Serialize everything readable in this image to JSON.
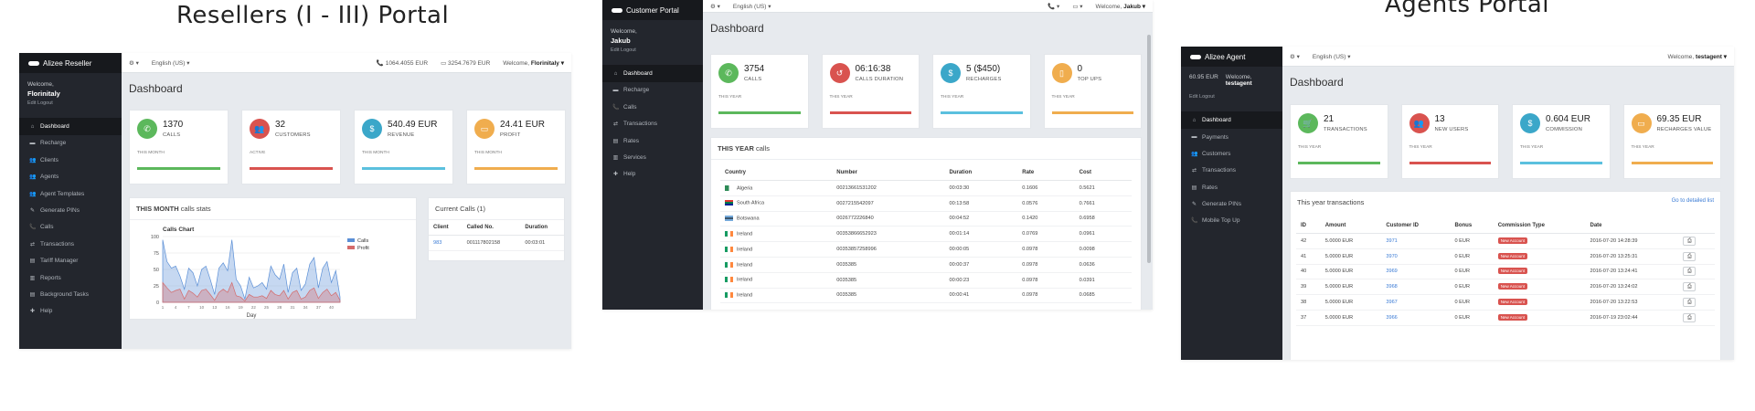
{
  "titles": {
    "reseller": "Resellers (I - III) Portal",
    "agent": "Agents Portal"
  },
  "colors": {
    "green": "#5cb85c",
    "red": "#d9534f",
    "blue": "#5bc0de",
    "orange": "#f0ad4e",
    "cyan": "#3ba7c9"
  },
  "reseller": {
    "brand": "Alizee Reseller",
    "welcome": "Welcome,",
    "user": "Florinitaly",
    "links": "Edit  Logout",
    "topbar": {
      "settings": "⚙ ▾",
      "lang": "English (US) ▾",
      "balance1": "📞 1064.4055 EUR",
      "balance2": "▭ 3254.7679 EUR",
      "welcome_label": "Welcome,",
      "welcome_user": "Florinitaly ▾"
    },
    "nav": [
      "Dashboard",
      "Recharge",
      "Clients",
      "Agents",
      "Agent Templates",
      "Generate PINs",
      "Calls",
      "Transactions",
      "Tariff Manager",
      "Reports",
      "Background Tasks",
      "Help"
    ],
    "nav_icons": [
      "⌂",
      "▬",
      "👥",
      "👥",
      "👥",
      "✎",
      "📞",
      "⇄",
      "▤",
      "▥",
      "▤",
      "✚"
    ],
    "dashboard": "Dashboard",
    "cards": [
      {
        "value": "1370",
        "label": "CALLS",
        "period": "THIS MONTH",
        "icon": "phone-icon",
        "glyph": "✆"
      },
      {
        "value": "32",
        "label": "CUSTOMERS",
        "period": "ACTIVE",
        "icon": "users-icon",
        "glyph": "👥"
      },
      {
        "value": "540.49 EUR",
        "label": "REVENUE",
        "period": "THIS MONTH",
        "icon": "money-icon",
        "glyph": "$"
      },
      {
        "value": "24.41 EUR",
        "label": "PROFIT",
        "period": "THIS MONTH",
        "icon": "credit-card-icon",
        "glyph": "▭"
      }
    ],
    "stats_head_bold": "THIS MONTH",
    "stats_head_rest": " calls stats",
    "current_calls": "Current Calls (1)",
    "current_cols": [
      "Client",
      "Called No.",
      "Duration"
    ],
    "current_rows": [
      [
        "983",
        "001117802158",
        "00:03:01"
      ]
    ]
  },
  "chart_data": {
    "type": "area",
    "title": "Calls Chart",
    "xlabel": "Day",
    "ylabel": "",
    "ylim": [
      0,
      100
    ],
    "yticks": [
      0,
      25,
      50,
      75,
      100
    ],
    "x": [
      1,
      2,
      3,
      4,
      5,
      6,
      7,
      8,
      9,
      10,
      11,
      12,
      13,
      14,
      15,
      16,
      17,
      18,
      19,
      20,
      21,
      22,
      23,
      24,
      25,
      26,
      27,
      28,
      29,
      30,
      31,
      32,
      33,
      34,
      35,
      36,
      37,
      38,
      39,
      40,
      41,
      42
    ],
    "series": [
      {
        "name": "Calls",
        "color": "#5b8fd6",
        "values": [
          95,
          62,
          52,
          55,
          40,
          20,
          52,
          45,
          25,
          50,
          55,
          35,
          12,
          52,
          60,
          48,
          95,
          35,
          25,
          5,
          38,
          22,
          25,
          30,
          20,
          55,
          42,
          35,
          58,
          15,
          45,
          52,
          18,
          28,
          58,
          68,
          22,
          52,
          62,
          30,
          48,
          8
        ]
      },
      {
        "name": "Profit",
        "color": "#d46b6b",
        "values": [
          30,
          22,
          15,
          18,
          20,
          5,
          18,
          14,
          8,
          18,
          20,
          12,
          3,
          15,
          20,
          15,
          30,
          10,
          8,
          2,
          12,
          8,
          8,
          10,
          6,
          18,
          12,
          10,
          18,
          5,
          15,
          18,
          5,
          8,
          18,
          22,
          6,
          15,
          20,
          10,
          15,
          3
        ]
      }
    ]
  },
  "customer": {
    "brand": "Customer Portal",
    "welcome": "Welcome,",
    "user": "Jakub",
    "links": "Edit  Logout",
    "topbar": {
      "settings": "⚙ ▾",
      "lang": "English (US) ▾",
      "phone": "📞 ▾",
      "card": "▭ ▾",
      "welcome_label": "Welcome,",
      "welcome_user": "Jakub ▾"
    },
    "nav": [
      "Dashboard",
      "Recharge",
      "Calls",
      "Transactions",
      "Rates",
      "Services",
      "Help"
    ],
    "nav_icons": [
      "⌂",
      "▬",
      "📞",
      "⇄",
      "▤",
      "▥",
      "✚"
    ],
    "dashboard": "Dashboard",
    "cards": [
      {
        "value": "3754",
        "label": "CALLS",
        "period": "THIS YEAR",
        "icon": "phone-icon",
        "glyph": "✆"
      },
      {
        "value": "06:16:38",
        "label": "CALLS DURATION",
        "period": "THIS YEAR",
        "icon": "history-icon",
        "glyph": "↺"
      },
      {
        "value": "5 ($450)",
        "label": "RECHARGES",
        "period": "THIS YEAR",
        "icon": "money-icon",
        "glyph": "$"
      },
      {
        "value": "0",
        "label": "TOP UPS",
        "period": "THIS YEAR",
        "icon": "mobile-icon",
        "glyph": "▯"
      }
    ],
    "calls_head_bold": "THIS YEAR",
    "calls_head_rest": " calls",
    "cols": [
      "Country",
      "Number",
      "Duration",
      "Rate",
      "Cost"
    ],
    "rows": [
      {
        "country": "Algeria",
        "number": "00213661531202",
        "duration": "00:03:30",
        "rate": "0.1606",
        "cost": "0.5621",
        "flag": "algeria"
      },
      {
        "country": "South Africa",
        "number": "0027215542097",
        "duration": "00:13:58",
        "rate": "0.0576",
        "cost": "0.7661",
        "flag": "south-africa"
      },
      {
        "country": "Botswana",
        "number": "0026772226840",
        "duration": "00:04:52",
        "rate": "0.1420",
        "cost": "0.6958",
        "flag": "botswana"
      },
      {
        "country": "Ireland",
        "number": "00353866652923",
        "duration": "00:01:14",
        "rate": "0.0769",
        "cost": "0.0961",
        "flag": "ireland"
      },
      {
        "country": "Ireland",
        "number": "00353857258996",
        "duration": "00:00:05",
        "rate": "0.0978",
        "cost": "0.0098",
        "flag": "ireland"
      },
      {
        "country": "Ireland",
        "number": "0035385",
        "duration": "00:00:37",
        "rate": "0.0978",
        "cost": "0.0636",
        "flag": "ireland"
      },
      {
        "country": "Ireland",
        "number": "0035385",
        "duration": "00:00:23",
        "rate": "0.0978",
        "cost": "0.0391",
        "flag": "ireland"
      },
      {
        "country": "Ireland",
        "number": "0035385",
        "duration": "00:00:41",
        "rate": "0.0978",
        "cost": "0.0685",
        "flag": "ireland"
      }
    ]
  },
  "agent": {
    "brand": "Alizee Agent",
    "balance": "60.95 EUR",
    "welcome": "Welcome,",
    "user": "testagent",
    "links": "Edit  Logout",
    "topbar": {
      "settings": "⚙ ▾",
      "lang": "English (US) ▾",
      "welcome_label": "Welcome,",
      "welcome_user": "testagent ▾"
    },
    "nav": [
      "Dashboard",
      "Payments",
      "Customers",
      "Transactions",
      "Rates",
      "Generate PINs",
      "Mobile Top Up"
    ],
    "nav_icons": [
      "⌂",
      "▬",
      "👥",
      "⇄",
      "▤",
      "✎",
      "📞"
    ],
    "dashboard": "Dashboard",
    "cards": [
      {
        "value": "21",
        "label": "TRANSACTIONS",
        "period": "THIS YEAR",
        "icon": "cart-icon",
        "glyph": "🛒"
      },
      {
        "value": "13",
        "label": "NEW USERS",
        "period": "THIS YEAR",
        "icon": "users-icon",
        "glyph": "👥"
      },
      {
        "value": "0.604 EUR",
        "label": "COMMISSION",
        "period": "THIS YEAR",
        "icon": "money-icon",
        "glyph": "$"
      },
      {
        "value": "69.35 EUR",
        "label": "RECHARGES VALUE",
        "period": "THIS YEAR",
        "icon": "credit-card-icon",
        "glyph": "▭"
      }
    ],
    "tx_head": "This year transactions",
    "tx_link": "Go to detailed list",
    "cols": [
      "ID",
      "Amount",
      "Customer ID",
      "Bonus",
      "Commission Type",
      "Date"
    ],
    "rows": [
      {
        "id": "42",
        "amount": "5.0000 EUR",
        "cid": "3971",
        "bonus": "0 EUR",
        "ctype": "New Account",
        "date": "2016-07-20 14:28:39"
      },
      {
        "id": "41",
        "amount": "5.0000 EUR",
        "cid": "3970",
        "bonus": "0 EUR",
        "ctype": "New Account",
        "date": "2016-07-20 13:25:31"
      },
      {
        "id": "40",
        "amount": "5.0000 EUR",
        "cid": "3969",
        "bonus": "0 EUR",
        "ctype": "New Account",
        "date": "2016-07-20 13:24:41"
      },
      {
        "id": "39",
        "amount": "5.0000 EUR",
        "cid": "3968",
        "bonus": "0 EUR",
        "ctype": "New Account",
        "date": "2016-07-20 13:24:02"
      },
      {
        "id": "38",
        "amount": "5.0000 EUR",
        "cid": "3967",
        "bonus": "0 EUR",
        "ctype": "New Account",
        "date": "2016-07-20 13:22:53"
      },
      {
        "id": "37",
        "amount": "5.0000 EUR",
        "cid": "3966",
        "bonus": "0 EUR",
        "ctype": "New Account",
        "date": "2016-07-19 23:02:44"
      }
    ]
  }
}
